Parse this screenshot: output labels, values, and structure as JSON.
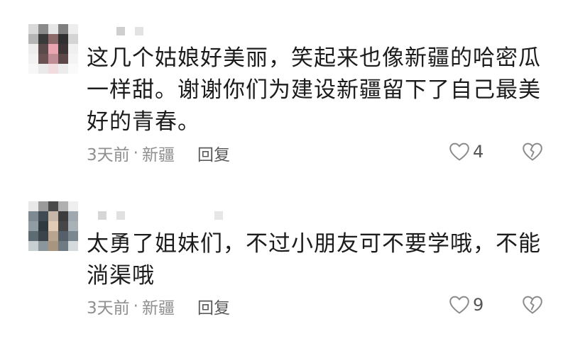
{
  "comments": [
    {
      "text": "这几个姑娘好美丽，笑起来也像新疆的哈密瓜一样甜。谢谢你们为建设新疆留下了自己最美好的青春。",
      "time": "3天前",
      "separator": "·",
      "location": "新疆",
      "reply_label": "回复",
      "likes": "4",
      "like_icon": "heart-outline-icon",
      "dislike_icon": "broken-heart-icon"
    },
    {
      "text": "太勇了姐妹们，不过小朋友可不要学哦，不能淌渠哦",
      "time": "3天前",
      "separator": "·",
      "location": "新疆",
      "reply_label": "回复",
      "likes": "9",
      "like_icon": "heart-outline-icon",
      "dislike_icon": "broken-heart-icon"
    }
  ],
  "colors": {
    "text": "#1c1c1c",
    "meta": "#8f8f8f",
    "icon": "#8a8a8a"
  }
}
